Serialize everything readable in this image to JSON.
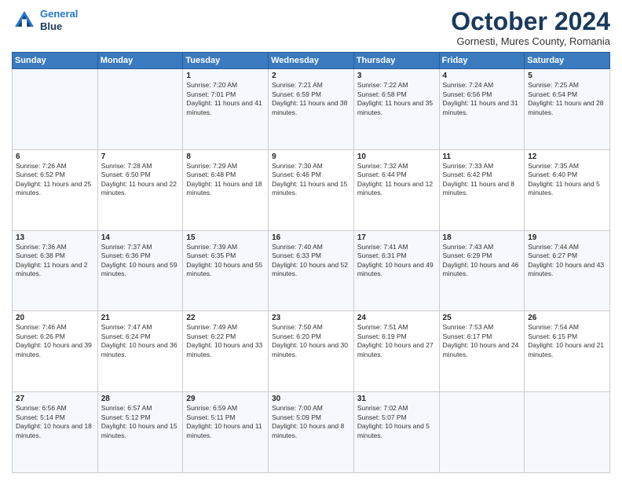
{
  "header": {
    "logo": {
      "line1": "General",
      "line2": "Blue"
    },
    "title": "October 2024",
    "location": "Gornesti, Mures County, Romania"
  },
  "weekdays": [
    "Sunday",
    "Monday",
    "Tuesday",
    "Wednesday",
    "Thursday",
    "Friday",
    "Saturday"
  ],
  "weeks": [
    [
      {
        "day": "",
        "sunrise": "",
        "sunset": "",
        "daylight": ""
      },
      {
        "day": "",
        "sunrise": "",
        "sunset": "",
        "daylight": ""
      },
      {
        "day": "1",
        "sunrise": "Sunrise: 7:20 AM",
        "sunset": "Sunset: 7:01 PM",
        "daylight": "Daylight: 11 hours and 41 minutes."
      },
      {
        "day": "2",
        "sunrise": "Sunrise: 7:21 AM",
        "sunset": "Sunset: 6:59 PM",
        "daylight": "Daylight: 11 hours and 38 minutes."
      },
      {
        "day": "3",
        "sunrise": "Sunrise: 7:22 AM",
        "sunset": "Sunset: 6:58 PM",
        "daylight": "Daylight: 11 hours and 35 minutes."
      },
      {
        "day": "4",
        "sunrise": "Sunrise: 7:24 AM",
        "sunset": "Sunset: 6:56 PM",
        "daylight": "Daylight: 11 hours and 31 minutes."
      },
      {
        "day": "5",
        "sunrise": "Sunrise: 7:25 AM",
        "sunset": "Sunset: 6:54 PM",
        "daylight": "Daylight: 11 hours and 28 minutes."
      }
    ],
    [
      {
        "day": "6",
        "sunrise": "Sunrise: 7:26 AM",
        "sunset": "Sunset: 6:52 PM",
        "daylight": "Daylight: 11 hours and 25 minutes."
      },
      {
        "day": "7",
        "sunrise": "Sunrise: 7:28 AM",
        "sunset": "Sunset: 6:50 PM",
        "daylight": "Daylight: 11 hours and 22 minutes."
      },
      {
        "day": "8",
        "sunrise": "Sunrise: 7:29 AM",
        "sunset": "Sunset: 6:48 PM",
        "daylight": "Daylight: 11 hours and 18 minutes."
      },
      {
        "day": "9",
        "sunrise": "Sunrise: 7:30 AM",
        "sunset": "Sunset: 6:46 PM",
        "daylight": "Daylight: 11 hours and 15 minutes."
      },
      {
        "day": "10",
        "sunrise": "Sunrise: 7:32 AM",
        "sunset": "Sunset: 6:44 PM",
        "daylight": "Daylight: 11 hours and 12 minutes."
      },
      {
        "day": "11",
        "sunrise": "Sunrise: 7:33 AM",
        "sunset": "Sunset: 6:42 PM",
        "daylight": "Daylight: 11 hours and 8 minutes."
      },
      {
        "day": "12",
        "sunrise": "Sunrise: 7:35 AM",
        "sunset": "Sunset: 6:40 PM",
        "daylight": "Daylight: 11 hours and 5 minutes."
      }
    ],
    [
      {
        "day": "13",
        "sunrise": "Sunrise: 7:36 AM",
        "sunset": "Sunset: 6:38 PM",
        "daylight": "Daylight: 11 hours and 2 minutes."
      },
      {
        "day": "14",
        "sunrise": "Sunrise: 7:37 AM",
        "sunset": "Sunset: 6:36 PM",
        "daylight": "Daylight: 10 hours and 59 minutes."
      },
      {
        "day": "15",
        "sunrise": "Sunrise: 7:39 AM",
        "sunset": "Sunset: 6:35 PM",
        "daylight": "Daylight: 10 hours and 55 minutes."
      },
      {
        "day": "16",
        "sunrise": "Sunrise: 7:40 AM",
        "sunset": "Sunset: 6:33 PM",
        "daylight": "Daylight: 10 hours and 52 minutes."
      },
      {
        "day": "17",
        "sunrise": "Sunrise: 7:41 AM",
        "sunset": "Sunset: 6:31 PM",
        "daylight": "Daylight: 10 hours and 49 minutes."
      },
      {
        "day": "18",
        "sunrise": "Sunrise: 7:43 AM",
        "sunset": "Sunset: 6:29 PM",
        "daylight": "Daylight: 10 hours and 46 minutes."
      },
      {
        "day": "19",
        "sunrise": "Sunrise: 7:44 AM",
        "sunset": "Sunset: 6:27 PM",
        "daylight": "Daylight: 10 hours and 43 minutes."
      }
    ],
    [
      {
        "day": "20",
        "sunrise": "Sunrise: 7:46 AM",
        "sunset": "Sunset: 6:26 PM",
        "daylight": "Daylight: 10 hours and 39 minutes."
      },
      {
        "day": "21",
        "sunrise": "Sunrise: 7:47 AM",
        "sunset": "Sunset: 6:24 PM",
        "daylight": "Daylight: 10 hours and 36 minutes."
      },
      {
        "day": "22",
        "sunrise": "Sunrise: 7:49 AM",
        "sunset": "Sunset: 6:22 PM",
        "daylight": "Daylight: 10 hours and 33 minutes."
      },
      {
        "day": "23",
        "sunrise": "Sunrise: 7:50 AM",
        "sunset": "Sunset: 6:20 PM",
        "daylight": "Daylight: 10 hours and 30 minutes."
      },
      {
        "day": "24",
        "sunrise": "Sunrise: 7:51 AM",
        "sunset": "Sunset: 6:19 PM",
        "daylight": "Daylight: 10 hours and 27 minutes."
      },
      {
        "day": "25",
        "sunrise": "Sunrise: 7:53 AM",
        "sunset": "Sunset: 6:17 PM",
        "daylight": "Daylight: 10 hours and 24 minutes."
      },
      {
        "day": "26",
        "sunrise": "Sunrise: 7:54 AM",
        "sunset": "Sunset: 6:15 PM",
        "daylight": "Daylight: 10 hours and 21 minutes."
      }
    ],
    [
      {
        "day": "27",
        "sunrise": "Sunrise: 6:56 AM",
        "sunset": "Sunset: 5:14 PM",
        "daylight": "Daylight: 10 hours and 18 minutes."
      },
      {
        "day": "28",
        "sunrise": "Sunrise: 6:57 AM",
        "sunset": "Sunset: 5:12 PM",
        "daylight": "Daylight: 10 hours and 15 minutes."
      },
      {
        "day": "29",
        "sunrise": "Sunrise: 6:59 AM",
        "sunset": "Sunset: 5:11 PM",
        "daylight": "Daylight: 10 hours and 11 minutes."
      },
      {
        "day": "30",
        "sunrise": "Sunrise: 7:00 AM",
        "sunset": "Sunset: 5:09 PM",
        "daylight": "Daylight: 10 hours and 8 minutes."
      },
      {
        "day": "31",
        "sunrise": "Sunrise: 7:02 AM",
        "sunset": "Sunset: 5:07 PM",
        "daylight": "Daylight: 10 hours and 5 minutes."
      },
      {
        "day": "",
        "sunrise": "",
        "sunset": "",
        "daylight": ""
      },
      {
        "day": "",
        "sunrise": "",
        "sunset": "",
        "daylight": ""
      }
    ]
  ]
}
